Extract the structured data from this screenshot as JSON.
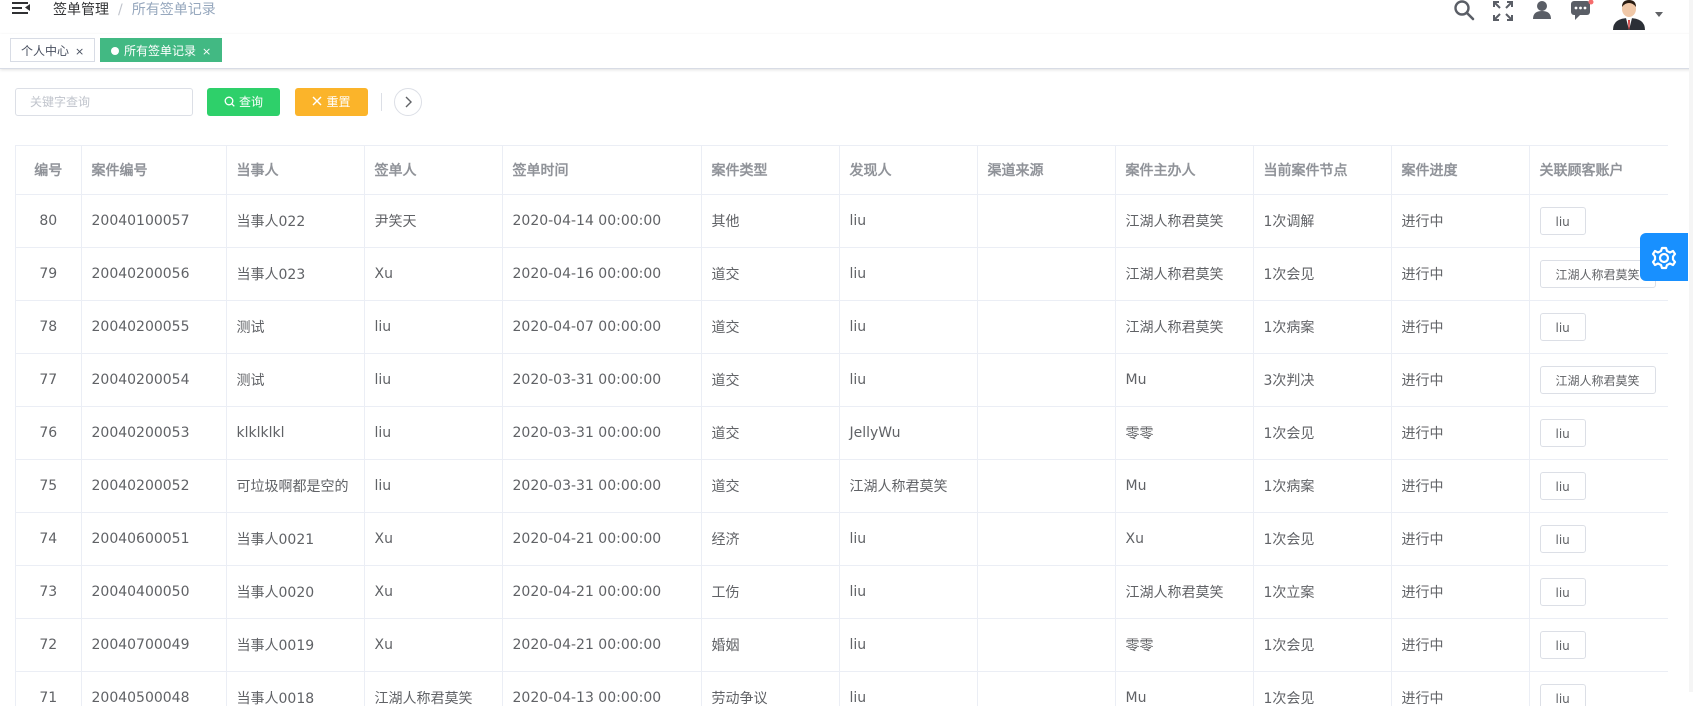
{
  "breadcrumb": {
    "root": "签单管理",
    "separator": "/",
    "current": "所有签单记录"
  },
  "navbar": {
    "icons": [
      "search-icon",
      "fullscreen-icon",
      "user-icon",
      "message-icon"
    ],
    "avatar": "avatar"
  },
  "tags": [
    {
      "label": "个人中心",
      "close": "×",
      "active": false
    },
    {
      "label": "所有签单记录",
      "close": "×",
      "active": true
    }
  ],
  "search": {
    "placeholder": "关键字查询",
    "value": "",
    "query_label": "查询",
    "reset_label": "重置"
  },
  "colors": {
    "query": "#2ed06a",
    "reset": "#fbb42a",
    "tag_active": "#42b983",
    "settings": "#1890ff"
  },
  "table": {
    "headers": [
      "编号",
      "案件编号",
      "当事人",
      "签单人",
      "签单时间",
      "案件类型",
      "发现人",
      "渠道来源",
      "案件主办人",
      "当前案件节点",
      "案件进度",
      "关联顾客账户"
    ],
    "rows": [
      [
        "80",
        "20040100057",
        "当事人022",
        "尹笑天",
        "2020-04-14 00:00:00",
        "其他",
        "liu",
        "",
        "江湖人称君莫笑",
        "1次调解",
        "进行中",
        "liu"
      ],
      [
        "79",
        "20040200056",
        "当事人023",
        "Xu",
        "2020-04-16 00:00:00",
        "道交",
        "liu",
        "",
        "江湖人称君莫笑",
        "1次会见",
        "进行中",
        "江湖人称君莫笑"
      ],
      [
        "78",
        "20040200055",
        "测试",
        "liu",
        "2020-04-07 00:00:00",
        "道交",
        "liu",
        "",
        "江湖人称君莫笑",
        "1次病案",
        "进行中",
        "liu"
      ],
      [
        "77",
        "20040200054",
        "测试",
        "liu",
        "2020-03-31 00:00:00",
        "道交",
        "liu",
        "",
        "Mu",
        "3次判决",
        "进行中",
        "江湖人称君莫笑"
      ],
      [
        "76",
        "20040200053",
        "klklklkl",
        "liu",
        "2020-03-31 00:00:00",
        "道交",
        "JellyWu",
        "",
        "零零",
        "1次会见",
        "进行中",
        "liu"
      ],
      [
        "75",
        "20040200052",
        "可垃圾啊都是空的",
        "liu",
        "2020-03-31 00:00:00",
        "道交",
        "江湖人称君莫笑",
        "",
        "Mu",
        "1次病案",
        "进行中",
        "liu"
      ],
      [
        "74",
        "20040600051",
        "当事人0021",
        "Xu",
        "2020-04-21 00:00:00",
        "经济",
        "liu",
        "",
        "Xu",
        "1次会见",
        "进行中",
        "liu"
      ],
      [
        "73",
        "20040400050",
        "当事人0020",
        "Xu",
        "2020-04-21 00:00:00",
        "工伤",
        "liu",
        "",
        "江湖人称君莫笑",
        "1次立案",
        "进行中",
        "liu"
      ],
      [
        "72",
        "20040700049",
        "当事人0019",
        "Xu",
        "2020-04-21 00:00:00",
        "婚姻",
        "liu",
        "",
        "零零",
        "1次会见",
        "进行中",
        "liu"
      ],
      [
        "71",
        "20040500048",
        "当事人0018",
        "江湖人称君莫笑",
        "2020-04-13 00:00:00",
        "劳动争议",
        "liu",
        "",
        "Mu",
        "1次会见",
        "进行中",
        "liu"
      ]
    ]
  }
}
